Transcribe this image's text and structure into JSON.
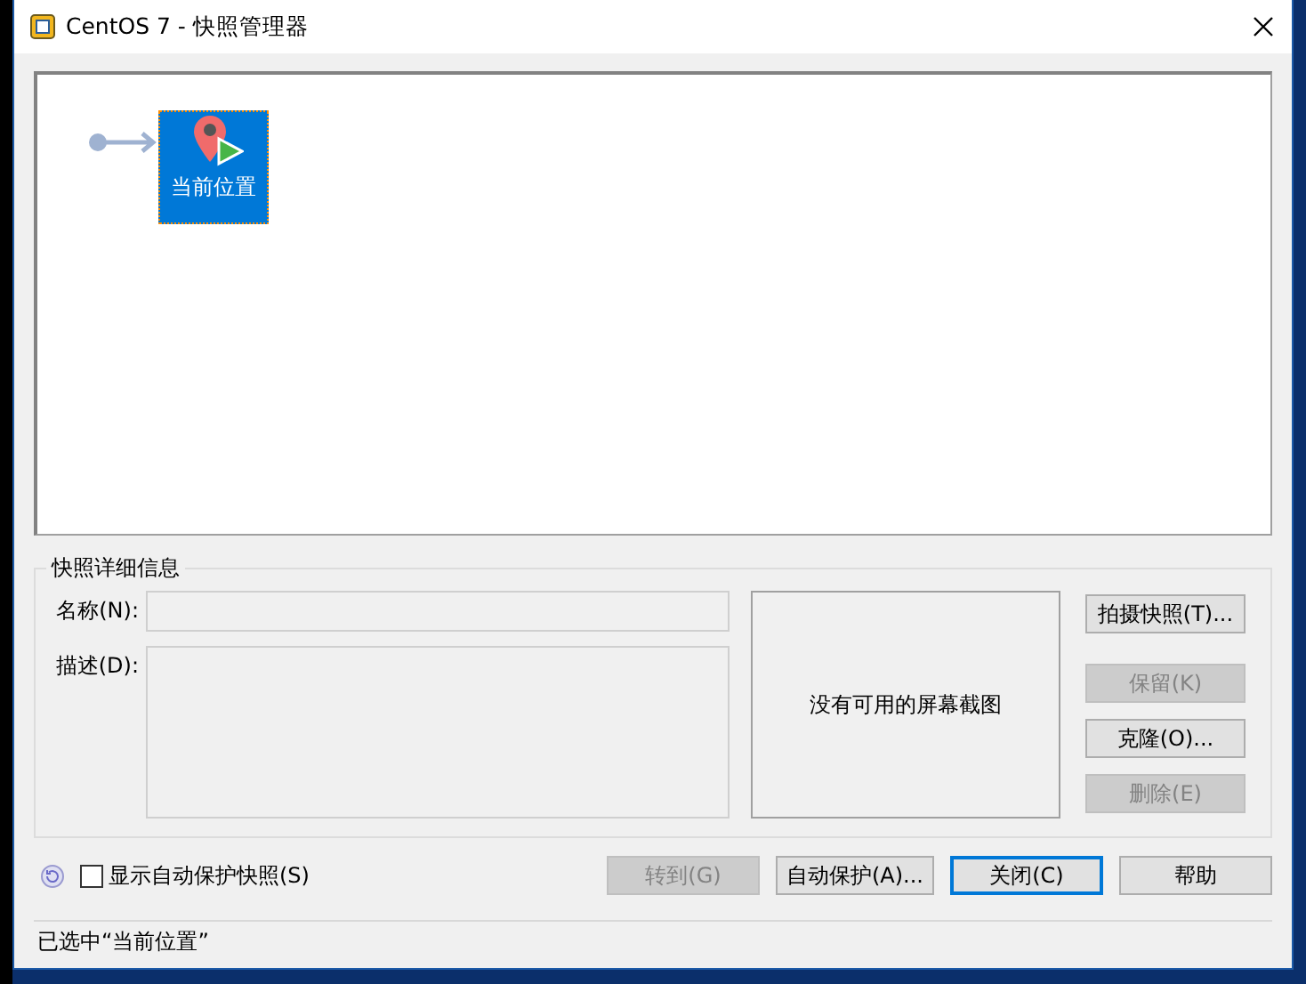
{
  "window": {
    "title": "CentOS 7 - 快照管理器"
  },
  "tree": {
    "nodes": [
      {
        "label": "当前位置",
        "selected": true
      }
    ]
  },
  "details": {
    "title": "快照详细信息",
    "fields": [
      {
        "kind": "line",
        "label": "名称(N):"
      },
      {
        "kind": "area",
        "label": "描述(D):"
      }
    ],
    "screenshot_text": "没有可用的屏幕截图"
  },
  "side_buttons": [
    {
      "label": "拍摄快照(T)...",
      "disabled": false
    },
    {
      "label": "保留(K)",
      "disabled": true
    },
    {
      "label": "克隆(O)...",
      "disabled": false
    },
    {
      "label": "删除(E)",
      "disabled": true
    }
  ],
  "show_autoprotect": {
    "label": "显示自动保护快照(S)",
    "checked": false
  },
  "bottom_buttons": [
    {
      "label": "转到(G)",
      "disabled": true,
      "focused": false
    },
    {
      "label": "自动保护(A)...",
      "disabled": false,
      "focused": false
    },
    {
      "label": "关闭(C)",
      "disabled": false,
      "focused": true
    },
    {
      "label": "帮助",
      "disabled": false,
      "focused": false
    }
  ],
  "status_bar": "已选中“当前位置”"
}
